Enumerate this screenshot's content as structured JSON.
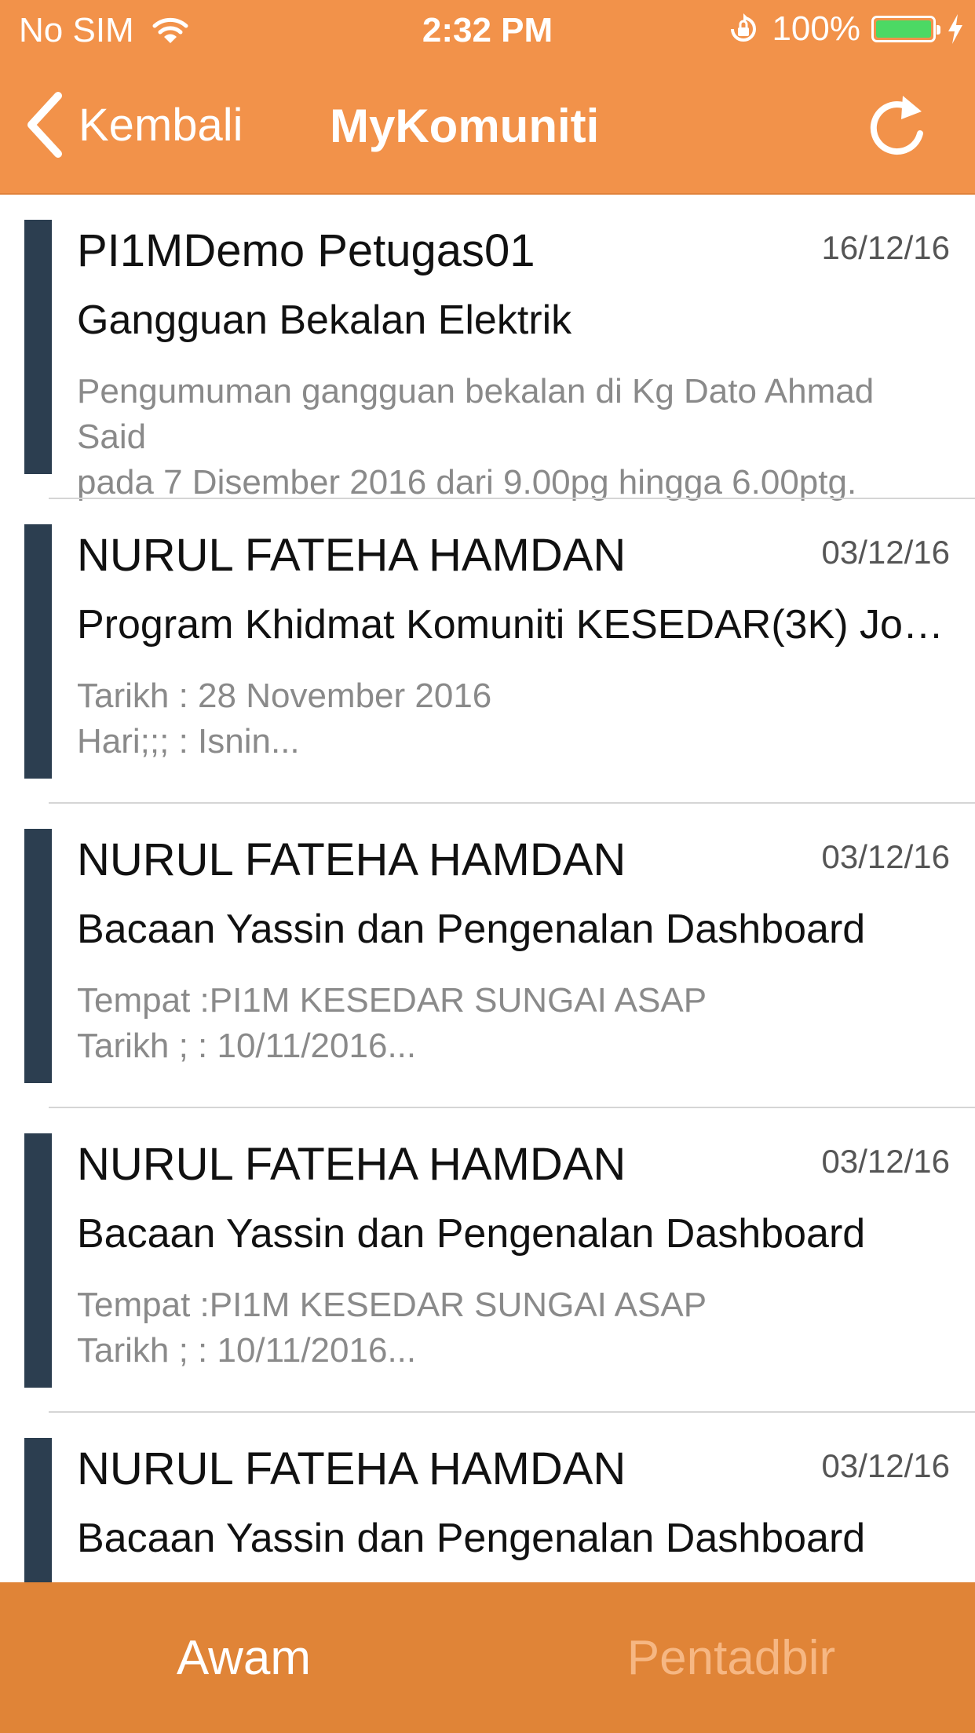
{
  "status_bar": {
    "carrier": "No SIM",
    "time": "2:32 PM",
    "battery_percent": "100%"
  },
  "nav": {
    "back_label": "Kembali",
    "title": "MyKomuniti"
  },
  "colors": {
    "header": "#F2924A",
    "tabbar": "#E08437",
    "accent_bar": "#2C3E50",
    "battery_fill": "#4CD964"
  },
  "icons": {
    "back": "chevron-left-icon",
    "refresh": "refresh-icon",
    "wifi": "wifi-icon",
    "rotation_lock": "rotation-lock-icon",
    "battery": "battery-icon",
    "charging": "charging-bolt-icon"
  },
  "items": [
    {
      "author": "PI1MDemo Petugas01",
      "date": "16/12/16",
      "title": "Gangguan Bekalan Elektrik",
      "body": "Pengumuman gangguan bekalan di Kg Dato Ahmad Said\npada 7 Disember 2016 dari 9.00pg hingga 6.00ptg."
    },
    {
      "author": "NURUL FATEHA HAMDAN",
      "date": "03/12/16",
      "title": "Program Khidmat Komuniti KESEDAR(3K)  Jom...",
      "body": "Tarikh : 28 November 2016\nHari;;; : Isnin..."
    },
    {
      "author": "NURUL FATEHA HAMDAN",
      "date": "03/12/16",
      "title": "Bacaan Yassin dan Pengenalan Dashboard",
      "body": "Tempat :PI1M KESEDAR SUNGAI ASAP\nTarikh ; : 10/11/2016..."
    },
    {
      "author": "NURUL FATEHA HAMDAN",
      "date": "03/12/16",
      "title": "Bacaan Yassin dan Pengenalan Dashboard",
      "body": "Tempat :PI1M KESEDAR SUNGAI ASAP\nTarikh ; : 10/11/2016..."
    },
    {
      "author": "NURUL FATEHA HAMDAN",
      "date": "03/12/16",
      "title": "Bacaan Yassin dan Pengenalan Dashboard",
      "body": ""
    }
  ],
  "tabs": [
    {
      "label": "Awam",
      "active": true
    },
    {
      "label": "Pentadbir",
      "active": false
    }
  ]
}
